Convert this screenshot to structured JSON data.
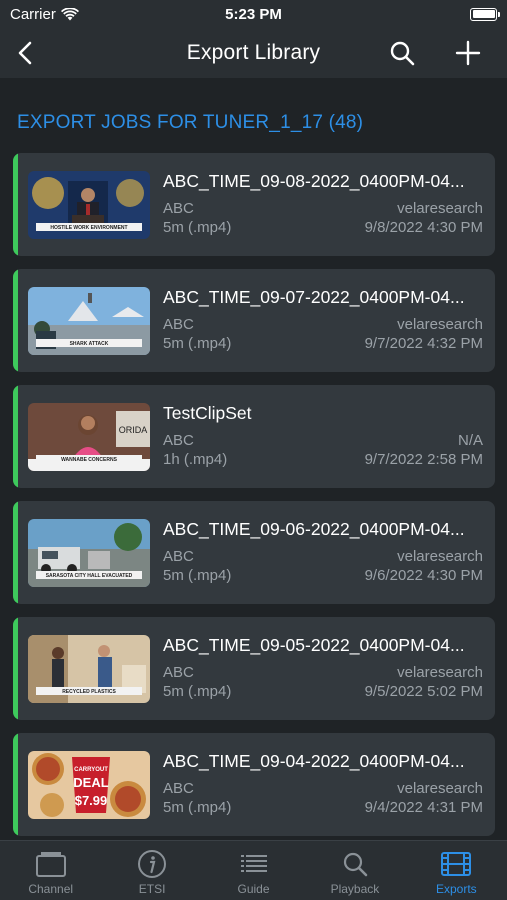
{
  "status_bar": {
    "carrier": "Carrier",
    "time": "5:23 PM"
  },
  "nav": {
    "title": "Export Library"
  },
  "section": {
    "header": "EXPORT JOBS FOR TUNER_1_17 (48)"
  },
  "jobs": [
    {
      "title": "ABC_TIME_09-08-2022_0400PM-04...",
      "channel": "ABC",
      "user": "velaresearch",
      "duration": "5m (.mp4)",
      "date": "9/8/2022 4:30 PM",
      "thumb": "podium",
      "caption": "HOSTILE WORK ENVIRONMENT"
    },
    {
      "title": "ABC_TIME_09-07-2022_0400PM-04...",
      "channel": "ABC",
      "user": "velaresearch",
      "duration": "5m (.mp4)",
      "date": "9/7/2022 4:32 PM",
      "thumb": "beach",
      "caption": "SHARK ATTACK"
    },
    {
      "title": "TestClipSet",
      "channel": "ABC",
      "user": "N/A",
      "duration": "1h (.mp4)",
      "date": "9/7/2022 2:58 PM",
      "thumb": "anchor",
      "caption": "WANNABE CONCERNS",
      "side_text": "ORIDA"
    },
    {
      "title": "ABC_TIME_09-06-2022_0400PM-04...",
      "channel": "ABC",
      "user": "velaresearch",
      "duration": "5m (.mp4)",
      "date": "9/6/2022 4:30 PM",
      "thumb": "street",
      "caption": "SARASOTA CITY HALL EVACUATED"
    },
    {
      "title": "ABC_TIME_09-05-2022_0400PM-04...",
      "channel": "ABC",
      "user": "velaresearch",
      "duration": "5m (.mp4)",
      "date": "9/5/2022 5:02 PM",
      "thumb": "indoor",
      "caption": "RECYCLED PLASTICS"
    },
    {
      "title": "ABC_TIME_09-04-2022_0400PM-04...",
      "channel": "ABC",
      "user": "velaresearch",
      "duration": "5m (.mp4)",
      "date": "9/4/2022 4:31 PM",
      "thumb": "pizza",
      "caption": "",
      "deal_top": "CARRYOUT",
      "deal_main": "DEAL",
      "deal_price": "$7.99"
    }
  ],
  "tabs": [
    {
      "label": "Channel",
      "icon": "tv-icon",
      "active": false
    },
    {
      "label": "ETSI",
      "icon": "info-icon",
      "active": false
    },
    {
      "label": "Guide",
      "icon": "list-icon",
      "active": false
    },
    {
      "label": "Playback",
      "icon": "search-icon",
      "active": false
    },
    {
      "label": "Exports",
      "icon": "film-icon",
      "active": true
    }
  ],
  "colors": {
    "accent": "#2d8fe6",
    "job_bar": "#3ec95c",
    "card": "#33393e"
  }
}
